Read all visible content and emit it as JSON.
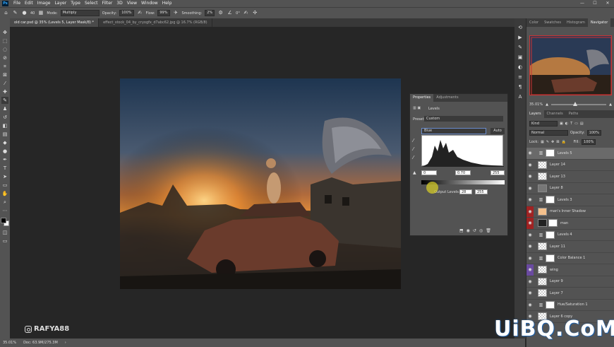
{
  "menubar": {
    "app_icon": "Ps",
    "items": [
      "File",
      "Edit",
      "Image",
      "Layer",
      "Type",
      "Select",
      "Filter",
      "3D",
      "View",
      "Window",
      "Help"
    ]
  },
  "optbar": {
    "brush_size": "40",
    "mode_label": "Mode:",
    "mode_value": "Multiply",
    "opacity_label": "Opacity:",
    "opacity_value": "100%",
    "flow_label": "Flow:",
    "flow_value": "99%",
    "smoothing_label": "Smoothing:",
    "smoothing_value": "2%",
    "angle_value": "0°"
  },
  "tabs": [
    {
      "label": "old car.psd @ 35% (Levels 5, Layer Mask/8) *",
      "active": true
    },
    {
      "label": "effect_stock_04_by_cryogfx_d7abc62.jpg @ 16.7% (RGB/8)",
      "active": false
    }
  ],
  "status": {
    "zoom": "35.01%",
    "doc": "Doc: 63.9M/275.3M"
  },
  "watermarks": {
    "top_left": "RAFYA88",
    "bottom_right": "UiBQ.CoM"
  },
  "properties": {
    "tabs": [
      "Properties",
      "Adjustments"
    ],
    "title": "Levels",
    "preset_label": "Preset:",
    "preset_value": "Custom",
    "channel_value": "Blue",
    "auto_label": "Auto",
    "input_black": "0",
    "input_gamma": "0.70",
    "input_white": "255",
    "output_label": "Output Levels:",
    "output_black": "28",
    "output_white": "255"
  },
  "right_tabs": [
    "Color",
    "Swatches",
    "Histogram",
    "Navigator"
  ],
  "navigator": {
    "zoom": "35.01%"
  },
  "layers_panel": {
    "tabs": [
      "Layers",
      "Channels",
      "Paths"
    ],
    "filter_value": "Kind",
    "blend_value": "Normal",
    "opacity_label": "Opacity:",
    "opacity_value": "100%",
    "lock_label": "Lock:",
    "fill_label": "Fill:",
    "fill_value": "100%"
  },
  "layers": [
    {
      "name": "Levels 5",
      "thumb": "adj",
      "mask": true,
      "selected": true,
      "eye": "normal"
    },
    {
      "name": "Layer 14",
      "thumb": "checker",
      "mask": false,
      "selected": false,
      "eye": "normal"
    },
    {
      "name": "Layer 13",
      "thumb": "checker",
      "mask": false,
      "selected": false,
      "eye": "normal"
    },
    {
      "name": "Layer 8",
      "thumb": "gray",
      "mask": false,
      "selected": false,
      "eye": "normal"
    },
    {
      "name": "Levels 3",
      "thumb": "adj",
      "mask": true,
      "selected": false,
      "eye": "normal"
    },
    {
      "name": "man's Inner Shadow",
      "thumb": "peach",
      "mask": false,
      "selected": false,
      "eye": "red"
    },
    {
      "name": "man",
      "thumb": "dark",
      "mask": true,
      "selected": false,
      "eye": "red"
    },
    {
      "name": "Levels 4",
      "thumb": "adj",
      "mask": true,
      "selected": false,
      "eye": "normal"
    },
    {
      "name": "Layer 11",
      "thumb": "checker",
      "mask": false,
      "selected": false,
      "eye": "normal"
    },
    {
      "name": "Color Balance 1",
      "thumb": "adj",
      "mask": true,
      "selected": false,
      "eye": "normal"
    },
    {
      "name": "wing",
      "thumb": "checker",
      "mask": false,
      "selected": false,
      "eye": "purple"
    },
    {
      "name": "Layer 9",
      "thumb": "checker",
      "mask": false,
      "selected": false,
      "eye": "normal"
    },
    {
      "name": "Layer 7",
      "thumb": "checker",
      "mask": false,
      "selected": false,
      "eye": "normal"
    },
    {
      "name": "Hue/Saturation 1",
      "thumb": "adj",
      "mask": true,
      "selected": false,
      "eye": "normal"
    },
    {
      "name": "Layer 6 copy",
      "thumb": "checker",
      "mask": false,
      "selected": false,
      "eye": "normal"
    }
  ]
}
